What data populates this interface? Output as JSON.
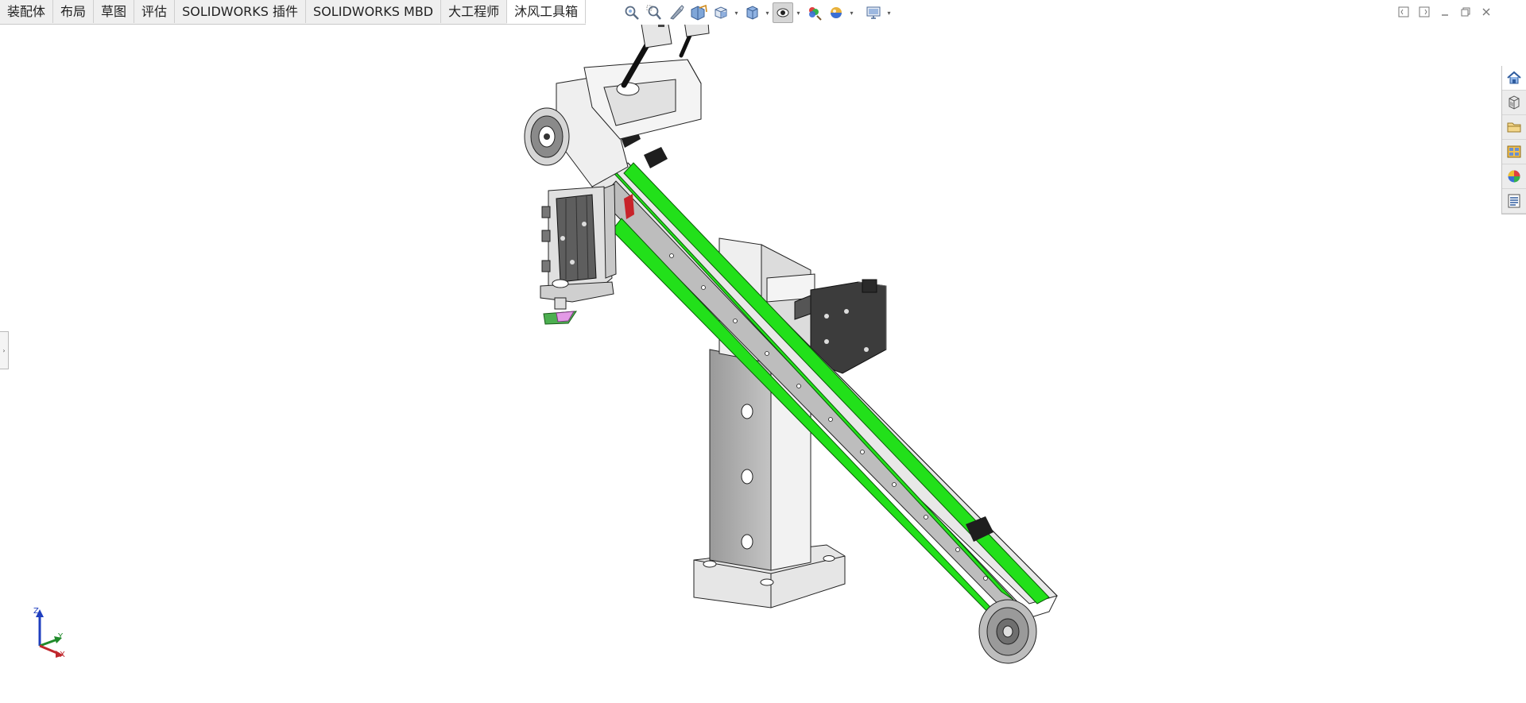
{
  "tabs": [
    {
      "label": "装配体"
    },
    {
      "label": "布局"
    },
    {
      "label": "草图"
    },
    {
      "label": "评估"
    },
    {
      "label": "SOLIDWORKS 插件"
    },
    {
      "label": "SOLIDWORKS MBD"
    },
    {
      "label": "大工程师"
    },
    {
      "label": "沐风工具箱"
    }
  ],
  "active_tab_index": 7,
  "hud_icons": [
    "zoom-to-fit-icon",
    "zoom-to-area-icon",
    "previous-view-icon",
    "section-view-icon",
    "view-orientation-icon",
    "display-style-icon",
    "hide-show-items-icon",
    "edit-appearance-icon",
    "apply-scene-icon",
    "view-settings-icon"
  ],
  "taskpane_icons": [
    "home-icon",
    "design-library-icon",
    "file-explorer-icon",
    "view-palette-icon",
    "appearances-icon",
    "custom-properties-icon"
  ],
  "triad": {
    "z": "Z",
    "y": "Y",
    "x": "X"
  },
  "colors": {
    "belt": "#22e01a",
    "frame": "#c8c8c8",
    "dark_part": "#3a3a3a",
    "accent_blue": "#1f5fbf"
  }
}
